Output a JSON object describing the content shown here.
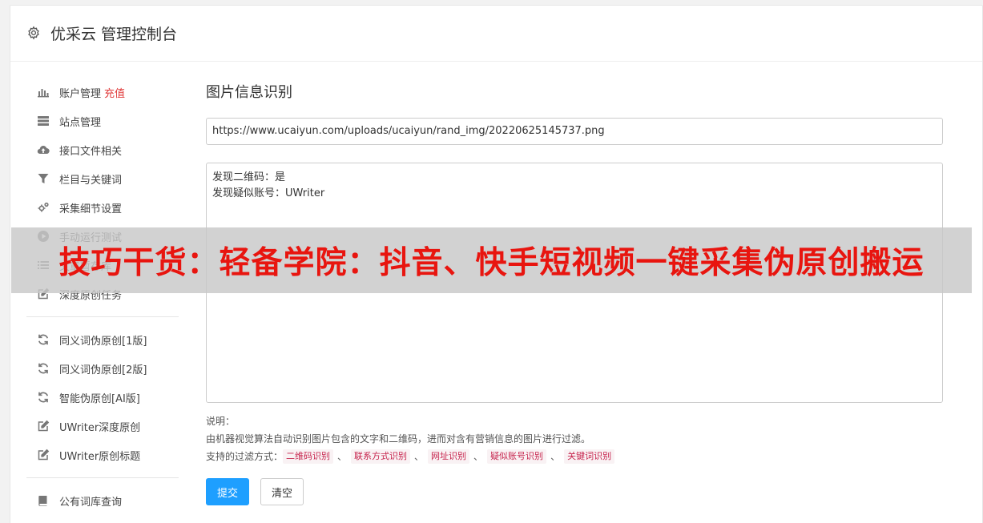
{
  "header": {
    "title": "优采云 管理控制台",
    "icon": "gear-icon"
  },
  "sidebar": {
    "group1": [
      {
        "label": "账户管理",
        "extra": "充值",
        "icon": "bar-chart-icon"
      },
      {
        "label": "站点管理",
        "icon": "server-icon"
      },
      {
        "label": "接口文件相关",
        "icon": "cloud-upload-icon"
      },
      {
        "label": "栏目与关键词",
        "icon": "filter-icon"
      },
      {
        "label": "采集细节设置",
        "icon": "cogs-icon"
      },
      {
        "label": "手动运行测试",
        "icon": "play-icon"
      },
      {
        "label": "文章暂存库",
        "icon": "list-icon"
      },
      {
        "label": "深度原创任务",
        "icon": "edit-icon"
      }
    ],
    "group2": [
      {
        "label": "同义词伪原创[1版]",
        "icon": "refresh-icon"
      },
      {
        "label": "同义词伪原创[2版]",
        "icon": "refresh-icon"
      },
      {
        "label": "智能伪原创[AI版]",
        "icon": "refresh-icon"
      },
      {
        "label": "UWriter深度原创",
        "icon": "edit-icon"
      },
      {
        "label": "UWriter原创标题",
        "icon": "edit-icon"
      }
    ],
    "group3": [
      {
        "label": "公有词库查询",
        "icon": "book-icon"
      }
    ]
  },
  "main": {
    "heading": "图片信息识别",
    "url_value": "https://www.ucaiyun.com/uploads/ucaiyun/rand_img/20220625145737.png",
    "result_lines": [
      "发现二维码：是",
      "发现疑似账号：UWriter"
    ],
    "note_title": "说明：",
    "note_desc": "由机器视觉算法自动识别图片包含的文字和二维码，进而对含有营销信息的图片进行过滤。",
    "filters_label": "支持的过滤方式：",
    "filters": [
      "二维码识别",
      "联系方式识别",
      "网址识别",
      "疑似账号识别",
      "关键词识别"
    ],
    "filter_sep": "、",
    "submit_label": "提交",
    "clear_label": "清空"
  },
  "watermark": {
    "text": "技巧干货：轻备学院：抖音、快手短视频一键采集伪原创搬运"
  },
  "colors": {
    "primary": "#1e9fff",
    "recharge": "#e03a3a",
    "watermark_text": "#e8150f",
    "tag_text": "#c7254e"
  }
}
